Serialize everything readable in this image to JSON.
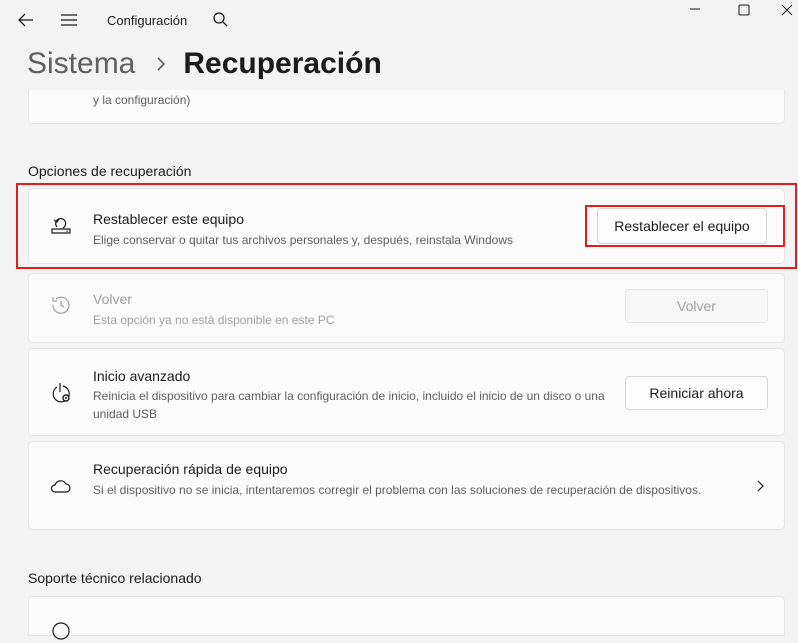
{
  "window": {
    "title": "Configuración"
  },
  "breadcrumb": {
    "parent": "Sistema",
    "current": "Recuperación"
  },
  "top_card": {
    "text": "y la configuración)"
  },
  "recovery_section": {
    "heading": "Opciones de recuperación",
    "items": [
      {
        "title": "Restablecer este equipo",
        "description": "Elige conservar o quitar tus archivos personales y, después, reinstala Windows",
        "button": "Restablecer el equipo",
        "icon": "reset-pc-icon"
      },
      {
        "title": "Volver",
        "description": "Esta opción ya no está disponible en este PC",
        "button": "Volver",
        "icon": "history-icon",
        "disabled": true
      },
      {
        "title": "Inicio avanzado",
        "description": "Reinicia el dispositivo para cambiar la configuración de inicio, incluido el inicio de un disco o una unidad USB",
        "button": "Reiniciar ahora",
        "icon": "power-gear-icon"
      },
      {
        "title": "Recuperación rápida de equipo",
        "description": "Si el dispositivo no se inicia, intentaremos corregir el problema con las soluciones de recuperación de dispositivos.",
        "icon": "cloud-icon"
      }
    ]
  },
  "support_section": {
    "heading": "Soporte técnico relacionado"
  },
  "colors": {
    "highlight": "#e11d1d",
    "background": "#f3f3f3",
    "card": "#fbfbfb"
  }
}
